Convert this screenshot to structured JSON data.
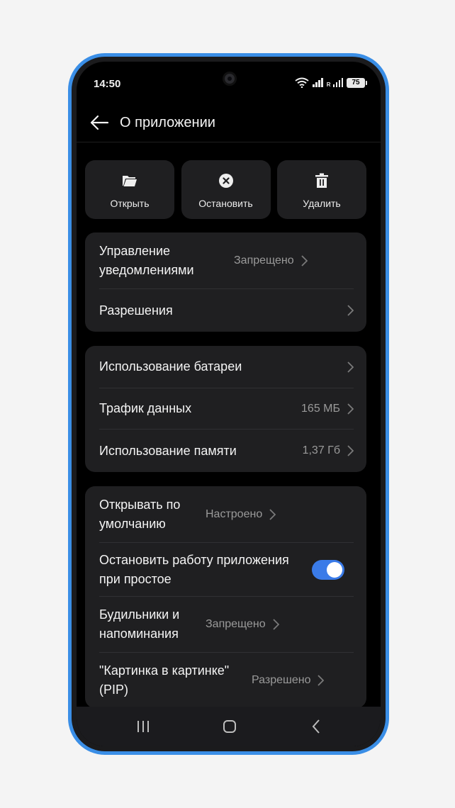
{
  "status": {
    "time": "14:50",
    "roaming": "R",
    "battery": "75"
  },
  "header": {
    "title": "О приложении"
  },
  "actions": {
    "open": "Открыть",
    "stop": "Остановить",
    "delete": "Удалить"
  },
  "group1": {
    "notifications": {
      "title": "Управление уведомлениями",
      "value": "Запрещено"
    },
    "permissions": {
      "title": "Разрешения"
    }
  },
  "group2": {
    "battery": {
      "title": "Использование батареи"
    },
    "traffic": {
      "title": "Трафик данных",
      "value": "165 МБ"
    },
    "memory": {
      "title": "Использование памяти",
      "value": "1,37 Гб"
    }
  },
  "group3": {
    "defaults": {
      "title": "Открывать по умолчанию",
      "value": "Настроено"
    },
    "idle_stop": {
      "title": "Остановить работу приложения при простое",
      "enabled": true
    },
    "alarms": {
      "title": "Будильники и напоминания",
      "value": "Запрещено"
    },
    "pip": {
      "title": "\"Картинка в картинке\" (PIP)",
      "value": "Разрешено"
    }
  },
  "colors": {
    "frame": "#3a8ee6",
    "accent": "#3a7be8",
    "card": "#1f1f21",
    "background": "#000000"
  }
}
